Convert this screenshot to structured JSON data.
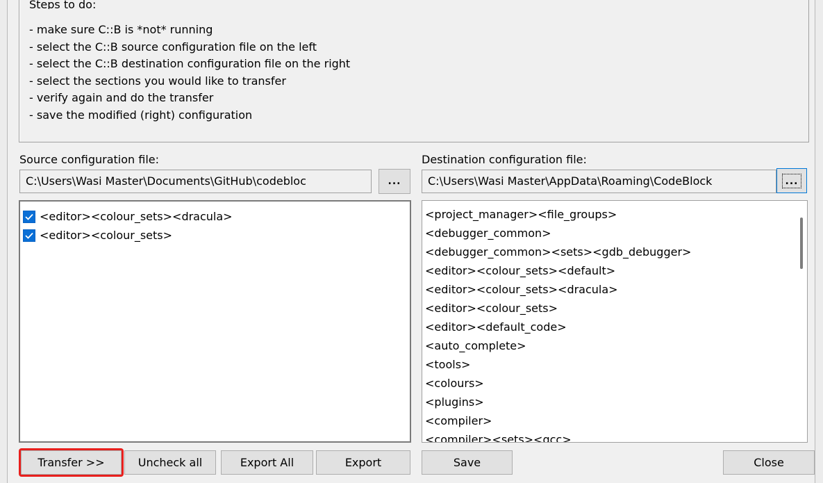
{
  "steps": {
    "title": "Steps to do:",
    "items": [
      "- make sure C::B is *not* running",
      "- select the C::B source configuration file on the left",
      "- select the C::B destination configuration file on the right",
      "- select the sections you would like to transfer",
      "- verify again and do the transfer",
      "- save the modified (right) configuration"
    ]
  },
  "source": {
    "label": "Source configuration file:",
    "path": "C:\\Users\\Wasi Master\\Documents\\GitHub\\codebloc",
    "browse_label": "...",
    "items": [
      {
        "text": "<editor><colour_sets><dracula>",
        "checked": true
      },
      {
        "text": "<editor><colour_sets>",
        "checked": true
      }
    ]
  },
  "destination": {
    "label": "Destination configuration file:",
    "path": "C:\\Users\\Wasi Master\\AppData\\Roaming\\CodeBlock",
    "browse_label": "...",
    "items": [
      "<project_manager><file_groups>",
      "<debugger_common>",
      "<debugger_common><sets><gdb_debugger>",
      "<editor><colour_sets><default>",
      "<editor><colour_sets><dracula>",
      "<editor><colour_sets>",
      "<editor><default_code>",
      "<auto_complete>",
      "<tools>",
      "<colours>",
      "<plugins>",
      "<compiler>",
      "<compiler><sets><gcc>"
    ]
  },
  "buttons": {
    "transfer": "Transfer >>",
    "uncheck_all": "Uncheck all",
    "export_all": "Export All",
    "export": "Export",
    "save": "Save",
    "close": "Close"
  },
  "colors": {
    "checkbox": "#0a6fd6",
    "highlight": "#e8201d"
  }
}
